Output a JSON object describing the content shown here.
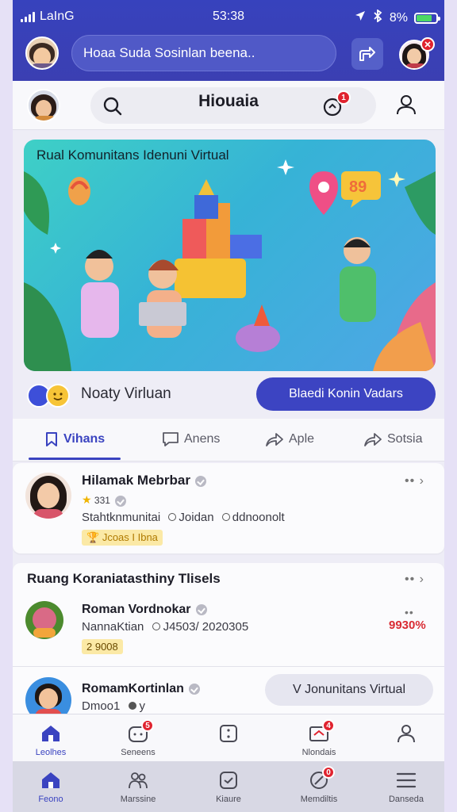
{
  "status_bar": {
    "carrier": "LaInG",
    "time": "53:38",
    "battery": "8%"
  },
  "top_bar": {
    "search_text": "Hoaa Suda Sosinlan beena.."
  },
  "header": {
    "title": "Hiouaia",
    "notification_count": "1"
  },
  "hero": {
    "title": "Rual Komunitans Idenuni Virtual"
  },
  "action_row": {
    "label": "Noaty Virluan",
    "button_label": "Blaedi Konin Vadars"
  },
  "tabs": [
    {
      "label": "Vihans",
      "icon": "bookmark-icon"
    },
    {
      "label": "Anens",
      "icon": "comment-icon"
    },
    {
      "label": "Aple",
      "icon": "share-icon"
    },
    {
      "label": "Sotsia",
      "icon": "share-icon"
    }
  ],
  "post1": {
    "name": "Hilamak Mebrbar",
    "rating": "331",
    "meta": [
      "Stahtknmunitai",
      "Joidan",
      "ddnoonolt"
    ],
    "tag": "Jcoas I Ibna"
  },
  "section2": {
    "title": "Ruang Koraniatasthiny Tlisels",
    "item1": {
      "name": "Roman Vordnokar",
      "meta": "NannaKtian",
      "date": "J4503/ 2020305",
      "tag": "2 9008",
      "value": "9930%",
      "value_color": "#d92b33"
    },
    "item2": {
      "name": "RomamKortinlan",
      "sub": "Dmoo1",
      "sub2": "y",
      "pill": "V Jonunitans Virtual"
    }
  },
  "nav1": [
    {
      "label": "Leolhes",
      "icon": "home-icon",
      "active": true
    },
    {
      "label": "Seneens",
      "icon": "emoji-icon",
      "badge": "5"
    },
    {
      "label": "",
      "icon": "dice-icon"
    },
    {
      "label": "Nlondais",
      "icon": "card-icon",
      "badge": "4"
    },
    {
      "label": "",
      "icon": "user-icon"
    }
  ],
  "nav2": [
    {
      "label": "Feono",
      "icon": "home-icon",
      "active": true
    },
    {
      "label": "Marssine",
      "icon": "people-icon"
    },
    {
      "label": "Kiaure",
      "icon": "smile-icon"
    },
    {
      "label": "Memdiltis",
      "icon": "message-icon",
      "badge": "0"
    },
    {
      "label": "Danseda",
      "icon": "menu-icon"
    }
  ]
}
